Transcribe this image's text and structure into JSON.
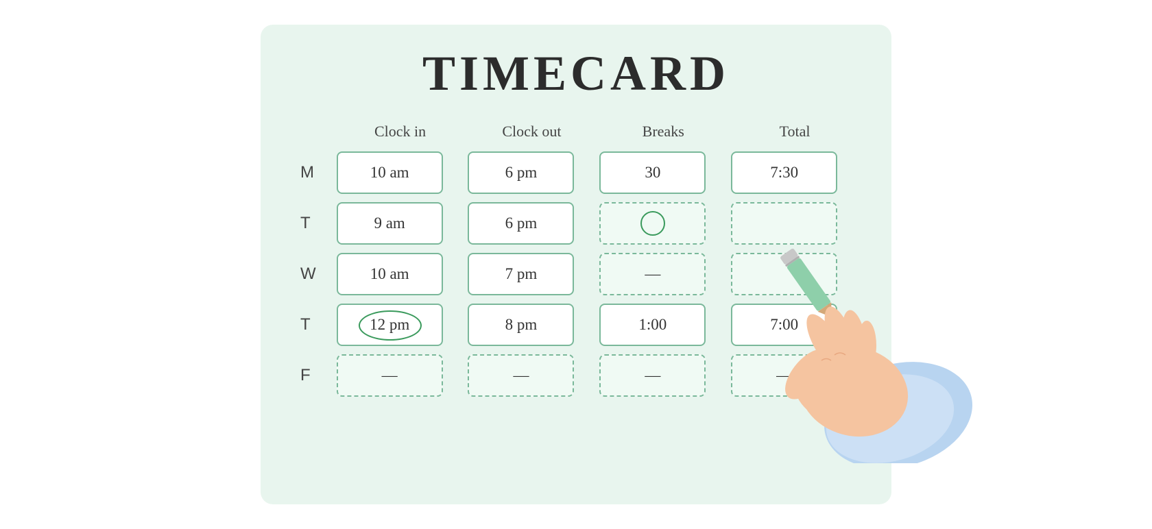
{
  "title": "TIMECARD",
  "columns": {
    "day": "",
    "clock_in": "Clock in",
    "clock_out": "Clock out",
    "breaks": "Breaks",
    "total": "Total"
  },
  "rows": [
    {
      "day": "M",
      "clock_in": {
        "value": "10 am",
        "style": "solid",
        "circled": false
      },
      "clock_out": {
        "value": "6 pm",
        "style": "solid",
        "circled": false
      },
      "breaks": {
        "value": "30",
        "style": "solid",
        "circled": false
      },
      "total": {
        "value": "7:30",
        "style": "solid",
        "circled": false
      }
    },
    {
      "day": "T",
      "clock_in": {
        "value": "9 am",
        "style": "solid",
        "circled": false
      },
      "clock_out": {
        "value": "6 pm",
        "style": "solid",
        "circled": false
      },
      "breaks": {
        "value": "",
        "style": "dashed",
        "circled": true
      },
      "total": {
        "value": "",
        "style": "dashed",
        "circled": false
      }
    },
    {
      "day": "W",
      "clock_in": {
        "value": "10 am",
        "style": "solid",
        "circled": false
      },
      "clock_out": {
        "value": "7 pm",
        "style": "solid",
        "circled": false
      },
      "breaks": {
        "value": "—",
        "style": "dashed",
        "circled": false
      },
      "total": {
        "value": "",
        "style": "dashed",
        "circled": false
      }
    },
    {
      "day": "T",
      "clock_in": {
        "value": "12 pm",
        "style": "solid",
        "circled": true
      },
      "clock_out": {
        "value": "8 pm",
        "style": "solid",
        "circled": false
      },
      "breaks": {
        "value": "1:00",
        "style": "solid",
        "circled": false
      },
      "total": {
        "value": "7:00",
        "style": "solid",
        "circled": false
      }
    },
    {
      "day": "F",
      "clock_in": {
        "value": "—",
        "style": "dashed",
        "circled": false
      },
      "clock_out": {
        "value": "—",
        "style": "dashed",
        "circled": false
      },
      "breaks": {
        "value": "—",
        "style": "dashed",
        "circled": false
      },
      "total": {
        "value": "—",
        "style": "dashed",
        "circled": false
      }
    }
  ]
}
